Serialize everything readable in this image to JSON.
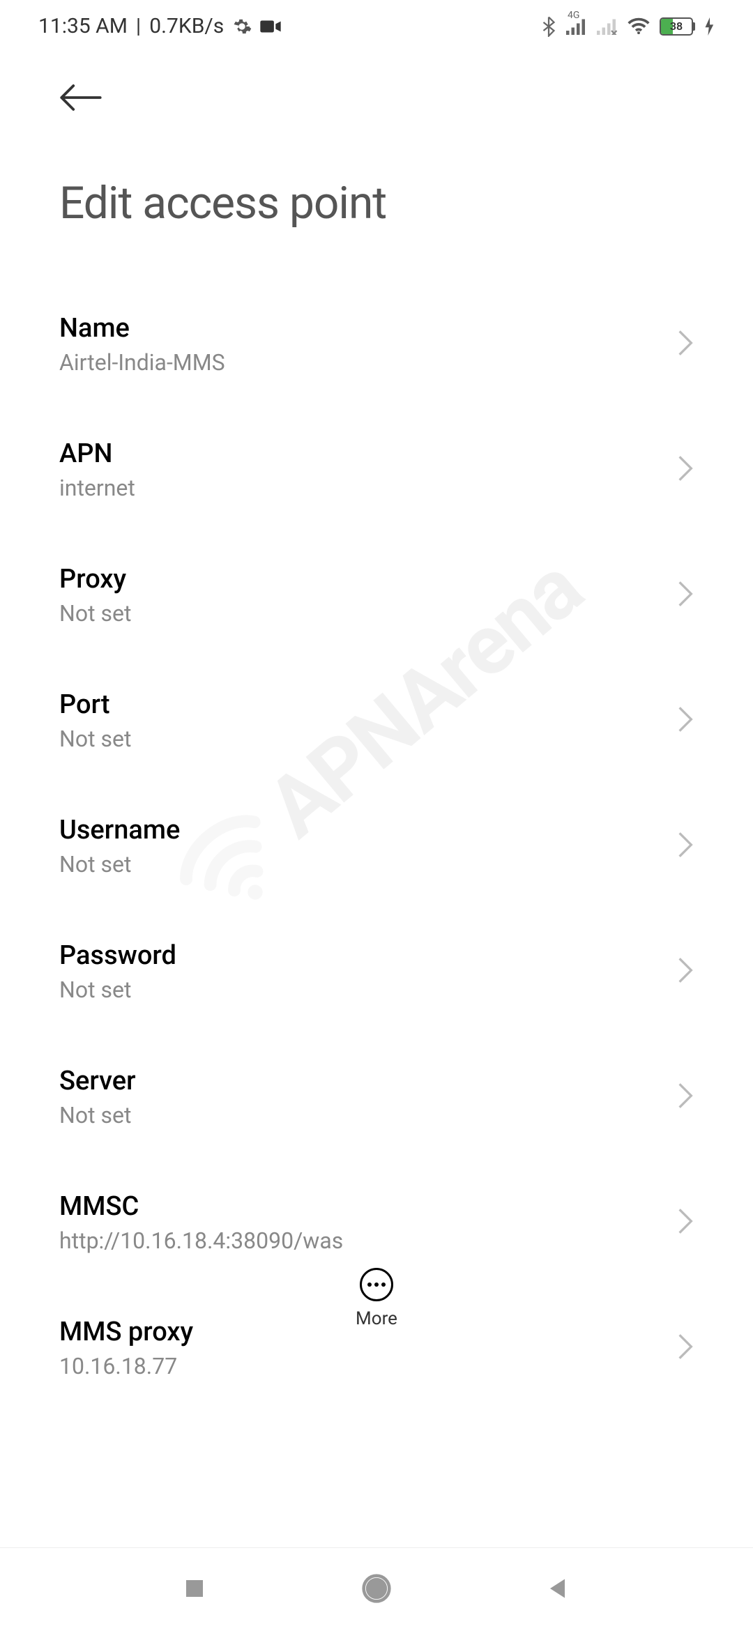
{
  "status_bar": {
    "time": "11:35 AM",
    "speed": "0.7KB/s",
    "battery_percent": "38",
    "network_type": "4G"
  },
  "header": {
    "title": "Edit access point"
  },
  "settings": [
    {
      "label": "Name",
      "value": "Airtel-India-MMS"
    },
    {
      "label": "APN",
      "value": "internet"
    },
    {
      "label": "Proxy",
      "value": "Not set"
    },
    {
      "label": "Port",
      "value": "Not set"
    },
    {
      "label": "Username",
      "value": "Not set"
    },
    {
      "label": "Password",
      "value": "Not set"
    },
    {
      "label": "Server",
      "value": "Not set"
    },
    {
      "label": "MMSC",
      "value": "http://10.16.18.4:38090/was"
    },
    {
      "label": "MMS proxy",
      "value": "10.16.18.77"
    }
  ],
  "more_button": {
    "label": "More"
  },
  "watermark": "APNArena"
}
